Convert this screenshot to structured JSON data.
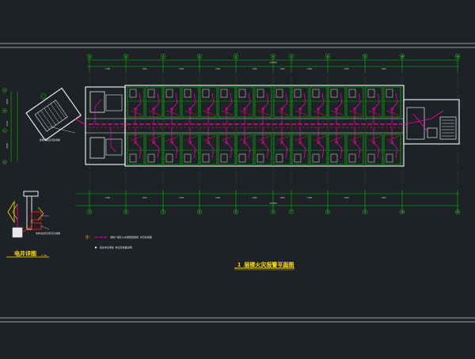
{
  "colors": {
    "background": "#1e2125",
    "border_lines": "#c8c8c8",
    "dimension_green": "#00c800",
    "axis_grid_circle": "#00b000",
    "walls_white": "#e8e8e8",
    "room_outline_green": "#00d000",
    "wiring_magenta": "#ff00b4",
    "wiring_red": "#ff2020",
    "title_yellow": "#ffe000",
    "label_white": "#ffffff"
  },
  "drawing": {
    "main_title": "1 层楼火灾报警平面图",
    "main_title_scale": "1:100",
    "detail_title": "电井详图",
    "detail_title_scale": "1:25",
    "legend_line_1": "消防广播及火灾报警控制线 详见系统图",
    "legend_line_2": "其余未注明处 参见系统图说明",
    "stair_note": "楼梯间做法详见建施图",
    "detail_note": "电井内设备安装详见系统图"
  },
  "dimensions": {
    "top_total": "54000",
    "bottom_total": "54000",
    "top_segments": [
      "7200",
      "7200",
      "7200",
      "7200",
      "7200",
      "7200",
      "7200",
      "7200",
      "7200"
    ],
    "bottom_segments": [
      "7200",
      "7200",
      "7200",
      "7200",
      "7200",
      "7200",
      "7200",
      "7200",
      "7200"
    ],
    "left_segments": [
      "4800",
      "2400",
      "4800"
    ]
  },
  "axes": {
    "top": [
      "1",
      "2",
      "3",
      "4",
      "5",
      "6",
      "7",
      "8",
      "9",
      "10",
      "11"
    ],
    "bottom": [
      "1",
      "2",
      "3",
      "4",
      "5",
      "6",
      "7",
      "8",
      "9",
      "10",
      "11"
    ],
    "left": [
      "A",
      "B",
      "C",
      "D"
    ]
  }
}
